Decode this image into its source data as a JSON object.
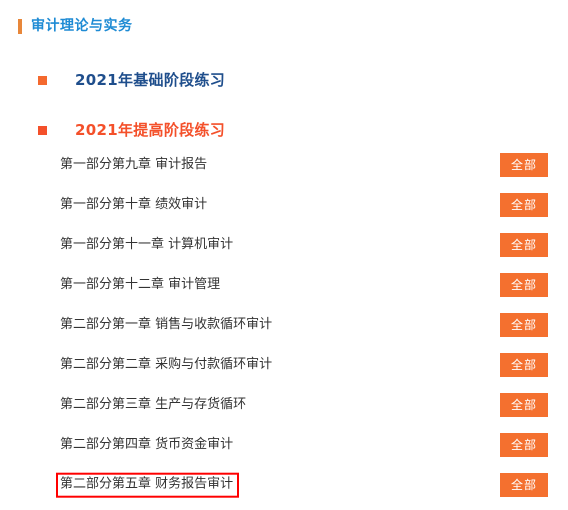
{
  "header": {
    "title": "审计理论与实务",
    "accent_bar_color": "#E8873A",
    "title_color": "#1E8BD4"
  },
  "sections": [
    {
      "label": "2021年基础阶段练习",
      "bullet_color": "#F4692E",
      "text_color": "#1F4E8C",
      "expanded": false,
      "chapters": []
    },
    {
      "label": "2021年提高阶段练习",
      "bullet_color": "#F4502A",
      "text_color": "#F4502A",
      "expanded": true,
      "chapters": [
        {
          "title": "第一部分第九章  审计报告",
          "button_label": "全部",
          "highlighted": false
        },
        {
          "title": "第一部分第十章  绩效审计",
          "button_label": "全部",
          "highlighted": false
        },
        {
          "title": "第一部分第十一章  计算机审计",
          "button_label": "全部",
          "highlighted": false
        },
        {
          "title": "第一部分第十二章  审计管理",
          "button_label": "全部",
          "highlighted": false
        },
        {
          "title": "第二部分第一章  销售与收款循环审计",
          "button_label": "全部",
          "highlighted": false
        },
        {
          "title": "第二部分第二章  采购与付款循环审计",
          "button_label": "全部",
          "highlighted": false
        },
        {
          "title": "第二部分第三章  生产与存货循环",
          "button_label": "全部",
          "highlighted": false
        },
        {
          "title": "第二部分第四章  货币资金审计",
          "button_label": "全部",
          "highlighted": false
        },
        {
          "title": "第二部分第五章  财务报告审计",
          "button_label": "全部",
          "highlighted": true
        }
      ]
    }
  ],
  "colors": {
    "button_background": "#F4702F",
    "button_text": "#FFFFFF",
    "highlight_border": "#FF0000",
    "chapter_text": "#333333",
    "page_background": "#FFFFFF"
  }
}
